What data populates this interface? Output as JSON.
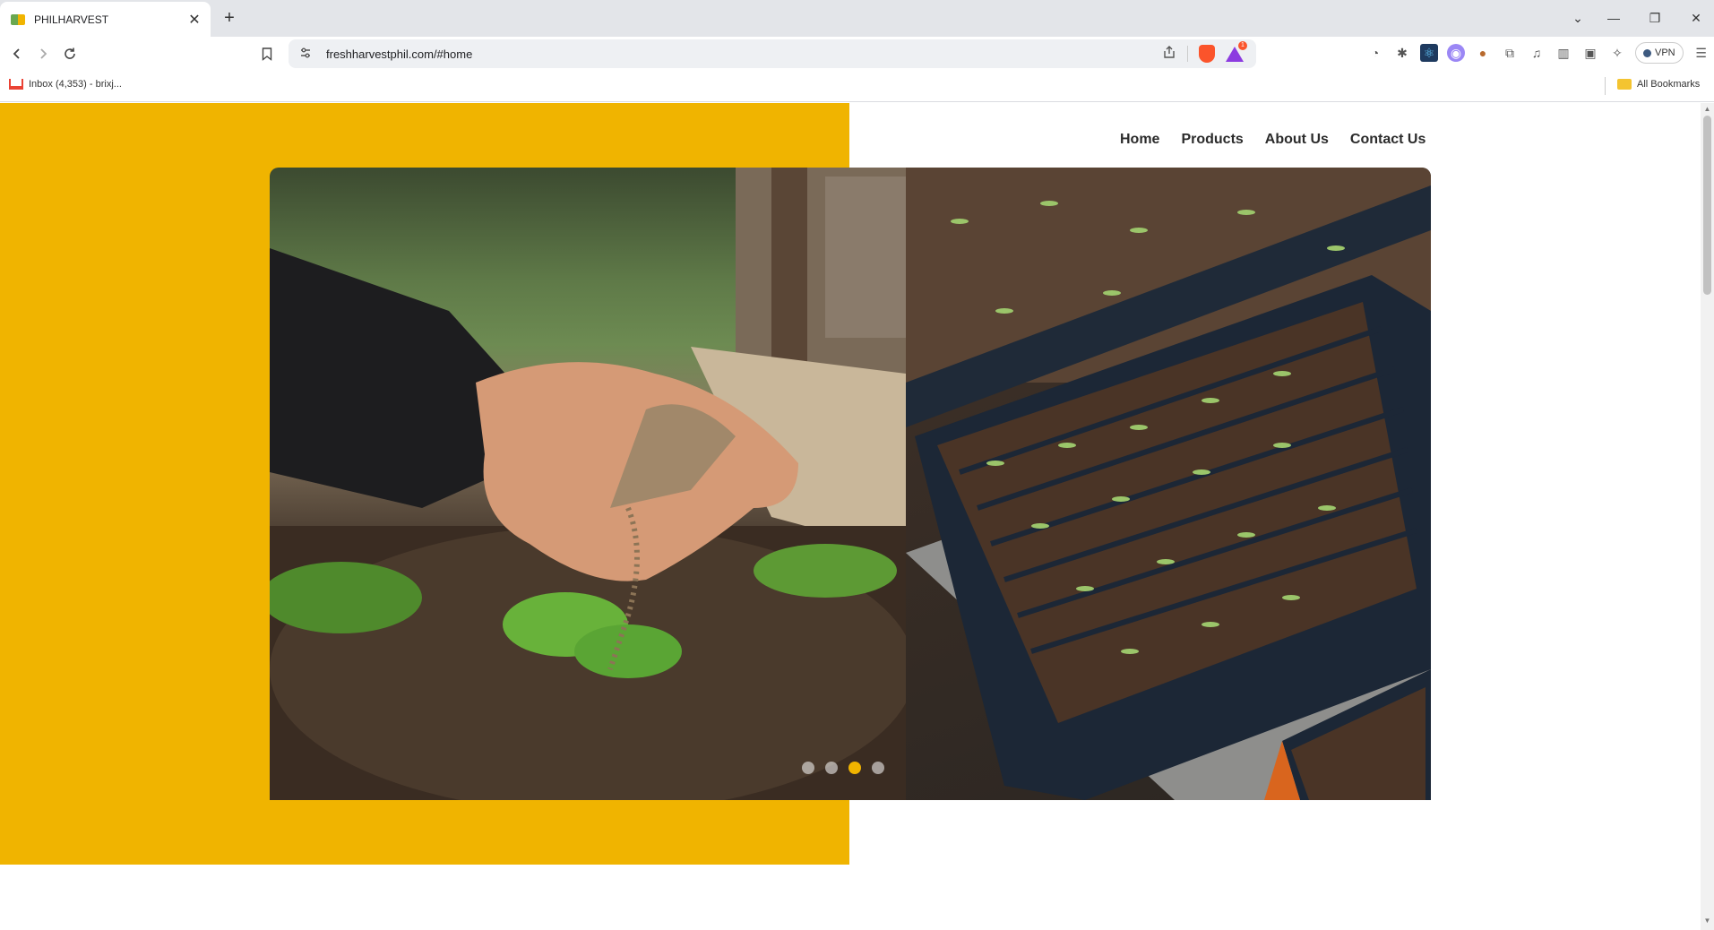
{
  "browser": {
    "tab": {
      "title": "PHILHARVEST",
      "close_glyph": "✕"
    },
    "new_tab_glyph": "+",
    "window_controls": {
      "tabs_dropdown": "⌄",
      "minimize": "—",
      "restore": "❐",
      "close": "✕"
    },
    "address_bar": {
      "url": "freshharvestphil.com/#home"
    },
    "brave_rewards_badge": "1",
    "vpn_label": "VPN",
    "bookmarks": [
      {
        "label": "Inbox (4,353) - brixj..."
      },
      {
        "label": "All Bookmarks"
      }
    ]
  },
  "site": {
    "nav": [
      {
        "label": "Home"
      },
      {
        "label": "Products"
      },
      {
        "label": "About Us"
      },
      {
        "label": "Contact Us"
      }
    ],
    "slider": {
      "slide_count": 4,
      "active_slide": 3
    },
    "colors": {
      "accent": "#f0b400",
      "nav_text": "#2b2b2b"
    }
  }
}
